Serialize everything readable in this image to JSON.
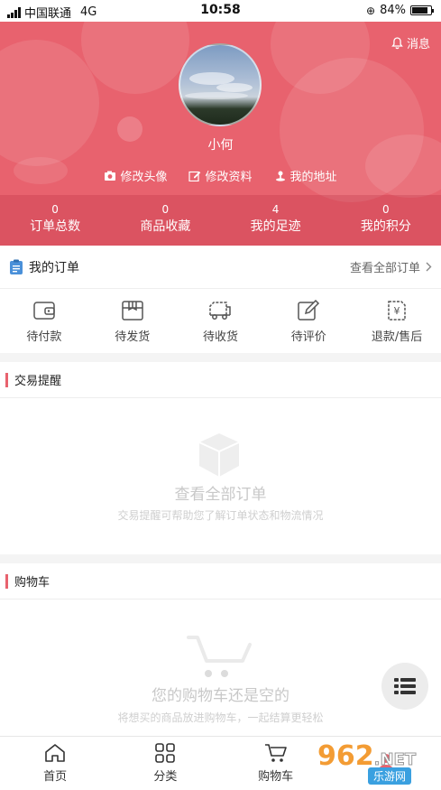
{
  "status_bar": {
    "carrier": "中国联通",
    "network": "4G",
    "time": "10:58",
    "battery": "84%",
    "battery_level": 0.84
  },
  "header": {
    "message_label": "消息",
    "username": "小何",
    "actions": [
      {
        "label": "修改头像",
        "icon": "camera-icon"
      },
      {
        "label": "修改资料",
        "icon": "edit-icon"
      },
      {
        "label": "我的地址",
        "icon": "location-icon"
      }
    ],
    "stats": [
      {
        "value": "0",
        "label": "订单总数"
      },
      {
        "value": "0",
        "label": "商品收藏"
      },
      {
        "value": "4",
        "label": "我的足迹"
      },
      {
        "value": "0",
        "label": "我的积分"
      }
    ]
  },
  "orders": {
    "title": "我的订单",
    "view_all": "查看全部订单",
    "items": [
      {
        "label": "待付款",
        "icon": "wallet-icon"
      },
      {
        "label": "待发货",
        "icon": "package-icon"
      },
      {
        "label": "待收货",
        "icon": "truck-icon"
      },
      {
        "label": "待评价",
        "icon": "review-icon"
      },
      {
        "label": "退款/售后",
        "icon": "refund-icon"
      }
    ]
  },
  "trade": {
    "title": "交易提醒",
    "empty_title": "查看全部订单",
    "empty_desc": "交易提醒可帮助您了解订单状态和物流情况"
  },
  "cart": {
    "title": "购物车",
    "empty_title": "您的购物车还是空的",
    "empty_desc": "将想买的商品放进购物车，一起结算更轻松"
  },
  "tabbar": [
    {
      "label": "首页",
      "icon": "home-icon"
    },
    {
      "label": "分类",
      "icon": "category-icon"
    },
    {
      "label": "购物车",
      "icon": "cart-icon"
    },
    {
      "label": "",
      "icon": "profile-icon"
    }
  ],
  "watermark": {
    "text1": "962",
    "text2": ".NET",
    "text3": "乐游网"
  },
  "colors": {
    "brand": "#e8626e",
    "accent_bar": "#e8626e"
  }
}
